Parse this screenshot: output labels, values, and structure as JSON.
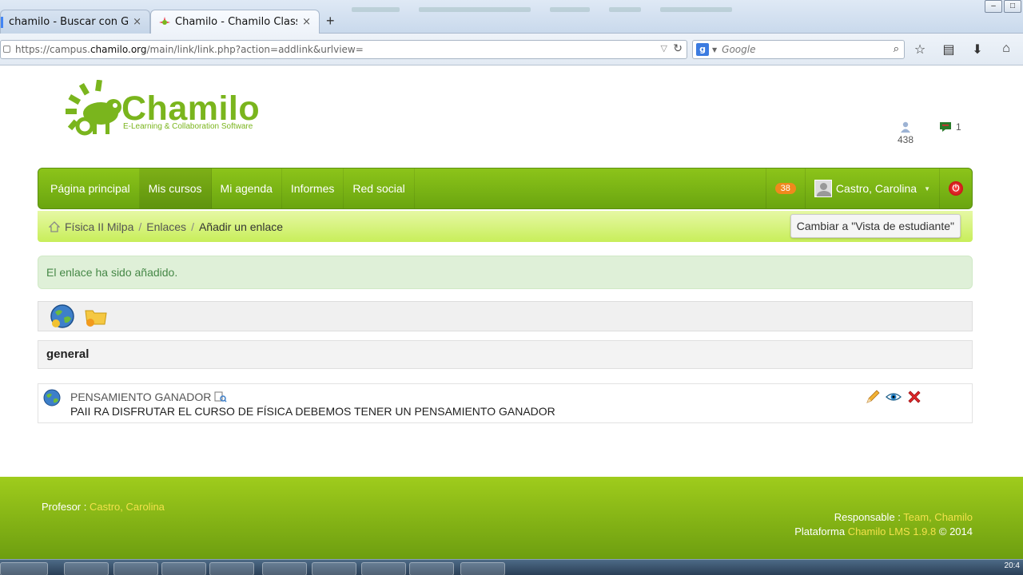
{
  "browser": {
    "tabs": [
      {
        "title": "chamilo - Buscar con Goo...",
        "active": false
      },
      {
        "title": "Chamilo - Chamilo Classic ...",
        "active": true
      }
    ],
    "new_tab": "+",
    "close": "×",
    "url_prefix": "https://campus.",
    "url_host": "chamilo.org",
    "url_path": "/main/link/link.php?action=addlink&urlview=",
    "search_placeholder": "Google"
  },
  "header": {
    "logo_title": "Chamilo",
    "logo_subtitle": "E-Learning & Collaboration Software",
    "online_users": "438",
    "messages": "1"
  },
  "nav": {
    "items": [
      {
        "label": "Página principal"
      },
      {
        "label": "Mis cursos",
        "active": true
      },
      {
        "label": "Mi agenda"
      },
      {
        "label": "Informes"
      },
      {
        "label": "Red social"
      }
    ],
    "badge": "38",
    "user": "Castro, Carolina"
  },
  "breadcrumb": {
    "items": [
      "Física II Milpa",
      "Enlaces"
    ],
    "separator": "/",
    "current": "Añadir un enlace",
    "switch_label": "Cambiar a \"Vista de estudiante\""
  },
  "alert": {
    "message": "El enlace ha sido añadido."
  },
  "category": {
    "name": "general"
  },
  "link": {
    "title": "PENSAMIENTO GANADOR",
    "description": "PAII RA DISFRUTAR EL CURSO DE FÍSICA DEBEMOS TENER UN PENSAMIENTO GANADOR"
  },
  "footer": {
    "teacher_label": "Profesor :",
    "teacher_name": "Castro, Carolina",
    "responsible_label": "Responsable :",
    "responsible_name": "Team, Chamilo",
    "platform_label": "Plataforma",
    "platform_name": "Chamilo LMS 1.9.8",
    "copyright": "© 2014"
  },
  "taskbar": {
    "clock": "20:4"
  },
  "colors": {
    "brand_green": "#7ab51d",
    "alert_green": "#dff0d8",
    "badge_orange": "#f0891d",
    "footer_highlight": "#f2e14b"
  }
}
